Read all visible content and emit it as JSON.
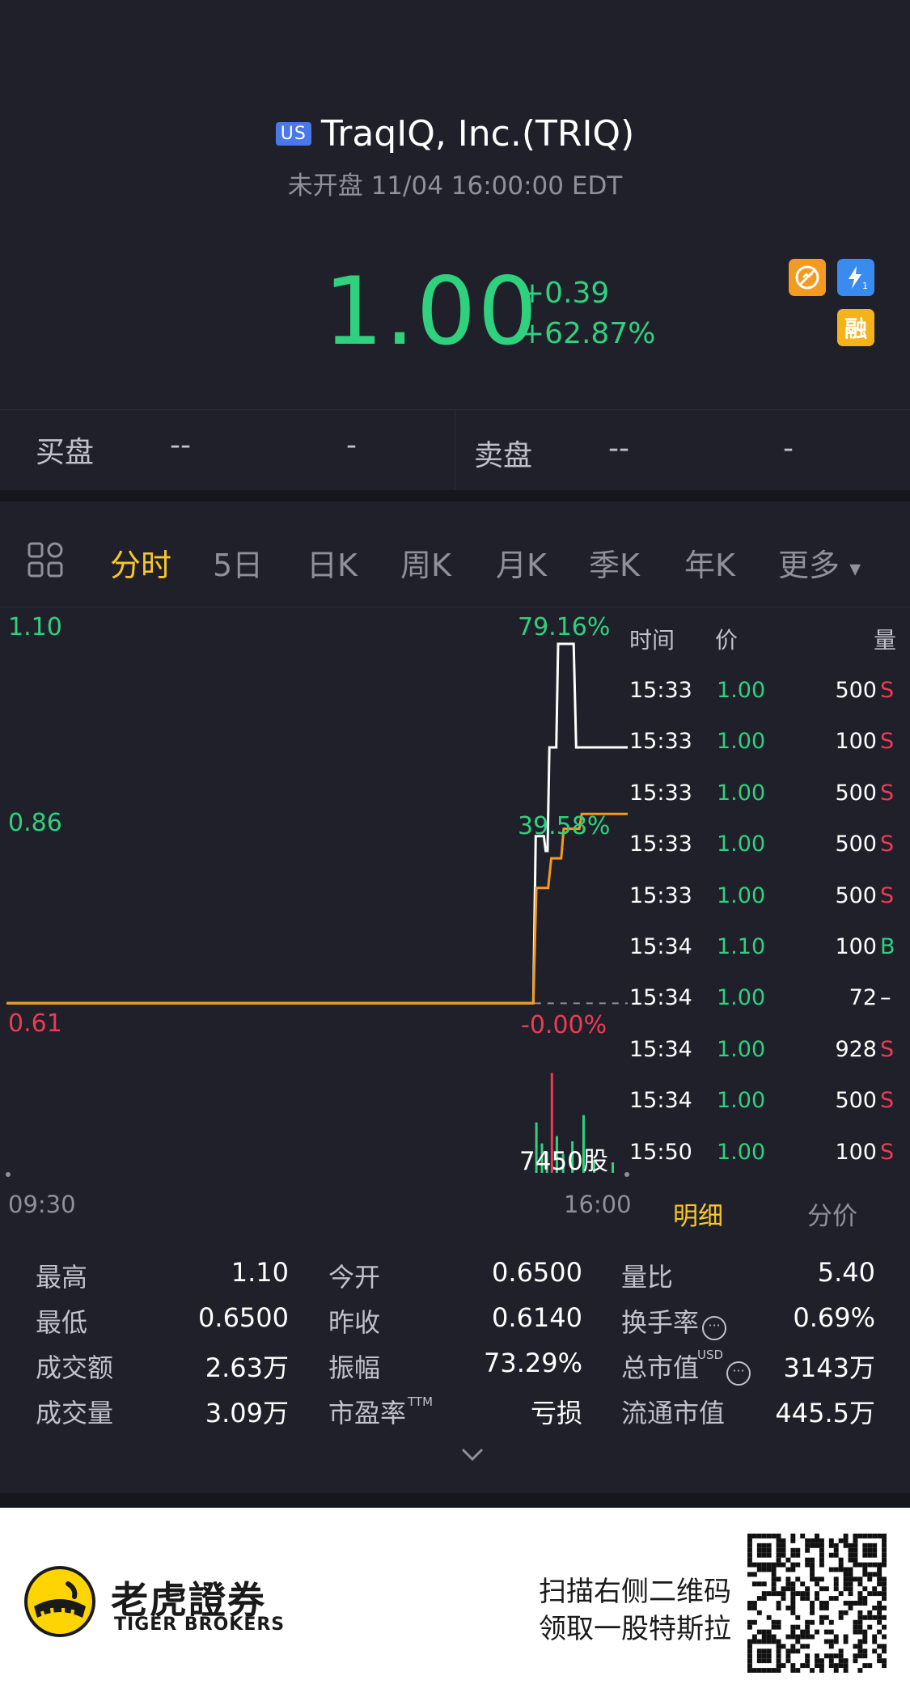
{
  "header": {
    "market_badge": "US",
    "title": "TraqIQ, Inc.(TRIQ)",
    "status": "未开盘 11/04 16:00:00 EDT"
  },
  "quote": {
    "price": "1.00",
    "change": "+0.39",
    "change_pct": "+62.87%",
    "tag_margin": "融"
  },
  "bid_ask": {
    "bid_label": "买盘",
    "bid_price": "--",
    "bid_size": "-",
    "ask_label": "卖盘",
    "ask_price": "--",
    "ask_size": "-"
  },
  "tabs": [
    "分时",
    "5日",
    "日K",
    "周K",
    "月K",
    "季K",
    "年K",
    "更多"
  ],
  "tab_more_arrow": "▾",
  "chart_data": {
    "type": "line",
    "y_left_ticks": [
      "1.10",
      "0.86",
      "0.61"
    ],
    "y_right_ticks": [
      "79.16%",
      "39.58%",
      "-0.00%"
    ],
    "x_ticks": [
      "09:30",
      "16:00"
    ],
    "ylim": [
      0.61,
      1.1
    ],
    "prev_close": 0.614,
    "series": [
      {
        "color": "#ffffff",
        "points": [
          [
            0.0,
            0.614
          ],
          [
            0.848,
            0.614
          ],
          [
            0.852,
            0.84
          ],
          [
            0.865,
            0.84
          ],
          [
            0.868,
            0.82
          ],
          [
            0.871,
            0.82
          ],
          [
            0.874,
            0.96
          ],
          [
            0.885,
            0.96
          ],
          [
            0.888,
            1.1
          ],
          [
            0.913,
            1.1
          ],
          [
            0.917,
            0.96
          ],
          [
            1.0,
            0.96
          ]
        ]
      },
      {
        "color": "#f39a1f",
        "points": [
          [
            0.0,
            0.614
          ],
          [
            0.848,
            0.614
          ],
          [
            0.853,
            0.77
          ],
          [
            0.872,
            0.77
          ],
          [
            0.877,
            0.81
          ],
          [
            0.893,
            0.81
          ],
          [
            0.897,
            0.85
          ],
          [
            0.922,
            0.85
          ],
          [
            0.926,
            0.87
          ],
          [
            0.96,
            0.87
          ],
          [
            1.0,
            0.87
          ]
        ]
      }
    ],
    "volume_label": "7450股",
    "volume_bars": [
      {
        "x": 0.853,
        "v": 0.48,
        "c": "#2fd17f"
      },
      {
        "x": 0.862,
        "v": 0.28,
        "c": "#2fd17f"
      },
      {
        "x": 0.87,
        "v": 0.2,
        "c": "#2fd17f"
      },
      {
        "x": 0.878,
        "v": 0.95,
        "c": "#ee3b54"
      },
      {
        "x": 0.886,
        "v": 0.35,
        "c": "#2fd17f"
      },
      {
        "x": 0.896,
        "v": 0.18,
        "c": "#2fd17f"
      },
      {
        "x": 0.911,
        "v": 0.3,
        "c": "#2fd17f"
      },
      {
        "x": 0.929,
        "v": 0.55,
        "c": "#2fd17f"
      },
      {
        "x": 0.946,
        "v": 0.12,
        "c": "#2fd17f"
      },
      {
        "x": 0.976,
        "v": 0.1,
        "c": "#2fd17f"
      }
    ]
  },
  "trades": {
    "headers": [
      "时间",
      "价",
      "量"
    ],
    "rows": [
      {
        "time": "15:33",
        "price": "1.00",
        "vol": "500",
        "side": "S",
        "side_color": "#ee3b54"
      },
      {
        "time": "15:33",
        "price": "1.00",
        "vol": "100",
        "side": "S",
        "side_color": "#ee3b54"
      },
      {
        "time": "15:33",
        "price": "1.00",
        "vol": "500",
        "side": "S",
        "side_color": "#ee3b54"
      },
      {
        "time": "15:33",
        "price": "1.00",
        "vol": "500",
        "side": "S",
        "side_color": "#ee3b54"
      },
      {
        "time": "15:33",
        "price": "1.00",
        "vol": "500",
        "side": "S",
        "side_color": "#ee3b54"
      },
      {
        "time": "15:34",
        "price": "1.10",
        "vol": "100",
        "side": "B",
        "side_color": "#2fd17f"
      },
      {
        "time": "15:34",
        "price": "1.00",
        "vol": "72",
        "side": "–",
        "side_color": "#ffffff"
      },
      {
        "time": "15:34",
        "price": "1.00",
        "vol": "928",
        "side": "S",
        "side_color": "#ee3b54"
      },
      {
        "time": "15:34",
        "price": "1.00",
        "vol": "500",
        "side": "S",
        "side_color": "#ee3b54"
      },
      {
        "time": "15:50",
        "price": "1.00",
        "vol": "100",
        "side": "S",
        "side_color": "#ee3b54"
      }
    ],
    "tab_detail": "明细",
    "tab_price": "分价"
  },
  "stats": {
    "high_label": "最高",
    "high": "1.10",
    "low_label": "最低",
    "low": "0.6500",
    "amount_label": "成交额",
    "amount": "2.63万",
    "volume_label": "成交量",
    "volume": "3.09万",
    "open_label": "今开",
    "open": "0.6500",
    "prev_close_label": "昨收",
    "prev_close": "0.6140",
    "amplitude_label": "振幅",
    "amplitude": "73.29%",
    "pe_label": "市盈率",
    "pe_sup": "TTM",
    "pe": "亏损",
    "vol_ratio_label": "量比",
    "vol_ratio": "5.40",
    "turnover_label": "换手率",
    "turnover": "0.69%",
    "mktcap_label": "总市值",
    "mktcap_sup": "USD",
    "mktcap": "3143万",
    "float_label": "流通市值",
    "float_cap": "445.5万"
  },
  "footer": {
    "brand_cn": "老虎證券",
    "brand_en": "TIGER BROKERS",
    "promo_line1": "扫描右侧二维码",
    "promo_line2": "领取一股特斯拉"
  }
}
